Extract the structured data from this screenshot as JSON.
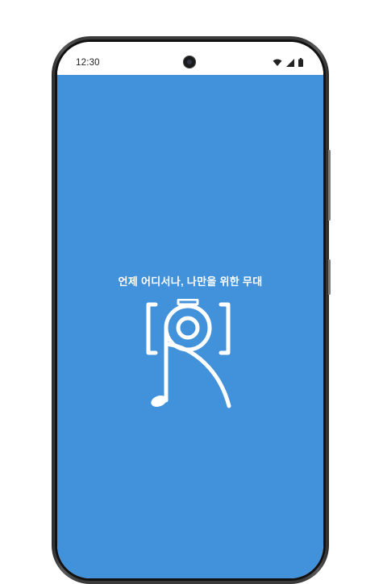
{
  "status_bar": {
    "time": "12:30",
    "icons": [
      "wifi-icon",
      "signal-icon",
      "battery-icon"
    ]
  },
  "splash": {
    "tagline": "언제 어디서나, 나만을 위한 무대",
    "logo": "camera-music-note-logo"
  },
  "colors": {
    "background": "#4291db",
    "logo": "#ffffff",
    "frame": "#3a3a3a"
  }
}
